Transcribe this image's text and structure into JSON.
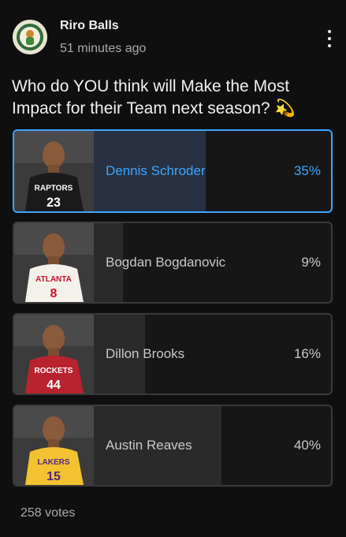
{
  "post": {
    "author": "Riro Balls",
    "time": "51 minutes ago",
    "question": "Who do YOU think will Make the Most Impact for their Team next season? 💫",
    "votes": "258 votes"
  },
  "poll": {
    "options": [
      {
        "name": "Dennis Schroder",
        "percent_label": "35%",
        "fraction": 0.35,
        "selected": true,
        "jersey_text": "RAPTORS",
        "number": "23",
        "jersey_color": "#1a1a1a"
      },
      {
        "name": "Bogdan Bogdanovic",
        "percent_label": "9%",
        "fraction": 0.09,
        "selected": false,
        "jersey_text": "ATLANTA",
        "number": "8",
        "jersey_color": "#f4f1ea"
      },
      {
        "name": "Dillon Brooks",
        "percent_label": "16%",
        "fraction": 0.16,
        "selected": false,
        "jersey_text": "ROCKETS",
        "number": "44",
        "jersey_color": "#b8232f"
      },
      {
        "name": "Austin Reaves",
        "percent_label": "40%",
        "fraction": 0.4,
        "selected": false,
        "jersey_text": "LAKERS",
        "number": "15",
        "jersey_color": "#f2c230"
      }
    ]
  },
  "icons": {
    "menu": "more-vert-icon",
    "avatar": "channel-avatar"
  },
  "colors": {
    "accent": "#3ea6ff",
    "background": "#0f0f0f"
  }
}
